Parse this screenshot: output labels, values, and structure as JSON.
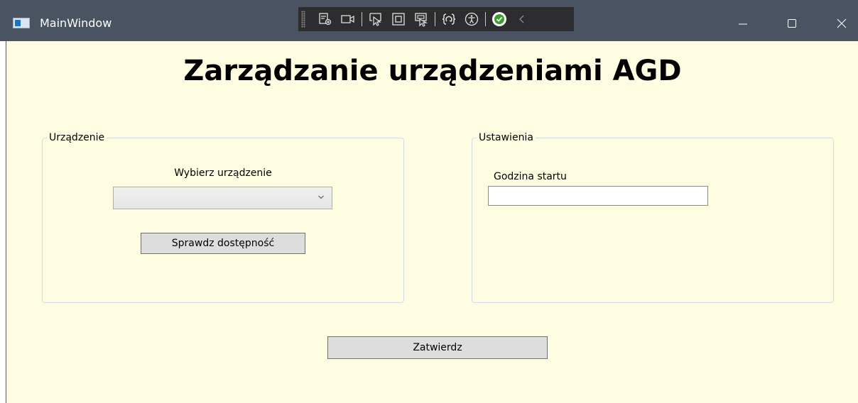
{
  "window": {
    "title": "MainWindow"
  },
  "toolbar": {
    "icons": [
      "select-element-icon",
      "video-icon",
      "pointer-select-icon",
      "highlight-layout-icon",
      "track-focus-icon",
      "hot-reload-icon",
      "accessibility-icon",
      "check-icon",
      "collapse-chevron-icon"
    ]
  },
  "main": {
    "title": "Zarządzanie urządzeniami AGD"
  },
  "device_group": {
    "header": "Urządzenie",
    "choose_label": "Wybierz urządzenie",
    "combo_selected": "",
    "check_button": "Sprawdz dostępność"
  },
  "settings_group": {
    "header": "Ustawienia",
    "start_label": "Godzina startu",
    "start_value": ""
  },
  "confirm_button": "Zatwierdz",
  "colors": {
    "titlebar": "#4a5361",
    "client_background": "#fffde1",
    "button_background": "#dddddd",
    "toolbar_background": "#2d2d30",
    "check_green": "#3e9b2e"
  }
}
